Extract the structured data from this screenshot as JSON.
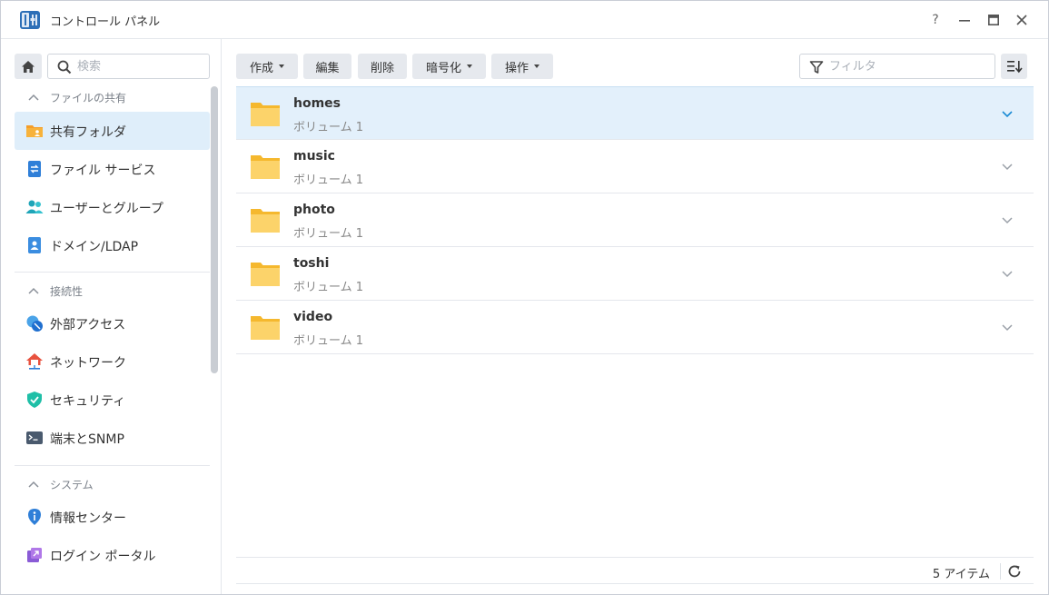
{
  "window": {
    "title": "コントロール パネル",
    "controls": {
      "help": "?"
    }
  },
  "sidebar": {
    "search_placeholder": "検索",
    "sections": [
      {
        "label": "ファイルの共有"
      },
      {
        "label": "接続性"
      },
      {
        "label": "システム"
      }
    ],
    "items": [
      {
        "label": "共有フォルダ",
        "icon": "shared-folder-icon"
      },
      {
        "label": "ファイル サービス",
        "icon": "file-services-icon"
      },
      {
        "label": "ユーザーとグループ",
        "icon": "users-groups-icon"
      },
      {
        "label": "ドメイン/LDAP",
        "icon": "domain-ldap-icon"
      },
      {
        "label": "外部アクセス",
        "icon": "external-access-icon"
      },
      {
        "label": "ネットワーク",
        "icon": "network-icon"
      },
      {
        "label": "セキュリティ",
        "icon": "security-shield-icon"
      },
      {
        "label": "端末とSNMP",
        "icon": "terminal-icon"
      },
      {
        "label": "情報センター",
        "icon": "info-center-icon"
      },
      {
        "label": "ログイン ポータル",
        "icon": "login-portal-icon"
      }
    ]
  },
  "toolbar": {
    "create": "作成",
    "edit": "編集",
    "delete": "削除",
    "encrypt": "暗号化",
    "action": "操作",
    "filter_placeholder": "フィルタ"
  },
  "folders": [
    {
      "name": "homes",
      "volume": "ボリューム 1"
    },
    {
      "name": "music",
      "volume": "ボリューム 1"
    },
    {
      "name": "photo",
      "volume": "ボリューム 1"
    },
    {
      "name": "toshi",
      "volume": "ボリューム 1"
    },
    {
      "name": "video",
      "volume": "ボリューム 1"
    }
  ],
  "footer": {
    "item_count": "5 アイテム"
  },
  "colors": {
    "accent": "#1a8ad4",
    "selected_row": "#e3f0fb",
    "folder": "#f9c440"
  }
}
